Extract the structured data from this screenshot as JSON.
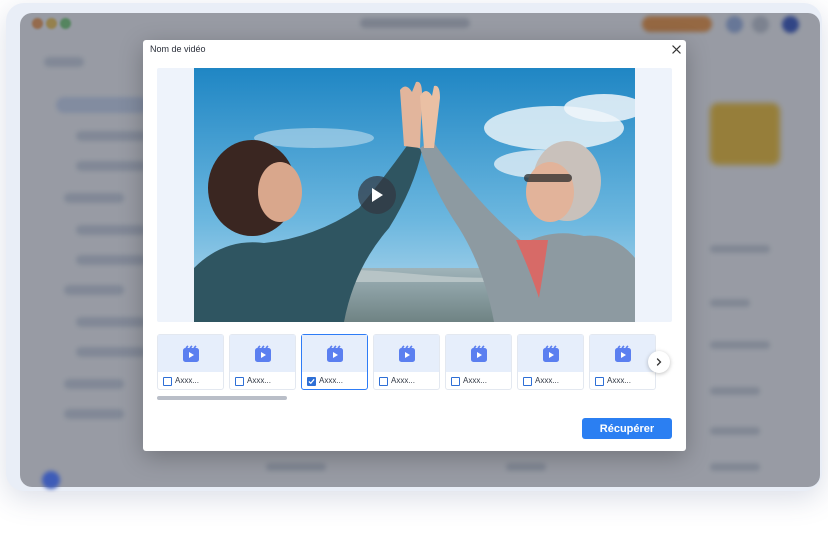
{
  "modal": {
    "title": "Nom de vidéo",
    "close_icon": "close-icon",
    "play_icon": "play-icon",
    "next_icon": "chevron-right-icon",
    "recover_label": "Récupérer"
  },
  "thumbnails": [
    {
      "label": "Axxx...",
      "checked": false,
      "icon": "video-clip-icon"
    },
    {
      "label": "Axxx...",
      "checked": false,
      "icon": "video-clip-icon"
    },
    {
      "label": "Axxx...",
      "checked": true,
      "icon": "video-clip-icon"
    },
    {
      "label": "Axxx...",
      "checked": false,
      "icon": "video-clip-icon"
    },
    {
      "label": "Axxx...",
      "checked": false,
      "icon": "video-clip-icon"
    },
    {
      "label": "Axxx...",
      "checked": false,
      "icon": "video-clip-icon"
    },
    {
      "label": "Axxx...",
      "checked": false,
      "icon": "video-clip-icon"
    },
    {
      "label": "",
      "checked": false,
      "icon": "video-clip-icon"
    }
  ],
  "colors": {
    "accent": "#2b7ff2",
    "thumb_bg": "#e6eefb",
    "overlay": "#232a3a"
  }
}
